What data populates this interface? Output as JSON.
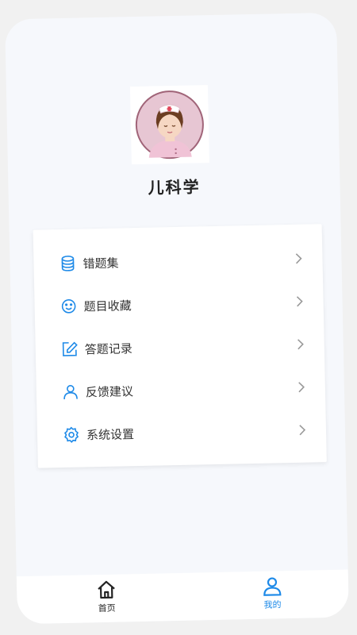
{
  "profile": {
    "title": "儿科学"
  },
  "menu": {
    "items": [
      {
        "label": "错题集",
        "icon": "database-icon"
      },
      {
        "label": "题目收藏",
        "icon": "smile-icon"
      },
      {
        "label": "答题记录",
        "icon": "edit-icon"
      },
      {
        "label": "反馈建议",
        "icon": "user-icon"
      },
      {
        "label": "系统设置",
        "icon": "gear-icon"
      }
    ]
  },
  "tabbar": {
    "home_label": "首页",
    "mine_label": "我的"
  },
  "colors": {
    "accent": "#1e8ae8",
    "background": "#f6f8fc",
    "card": "#ffffff"
  }
}
